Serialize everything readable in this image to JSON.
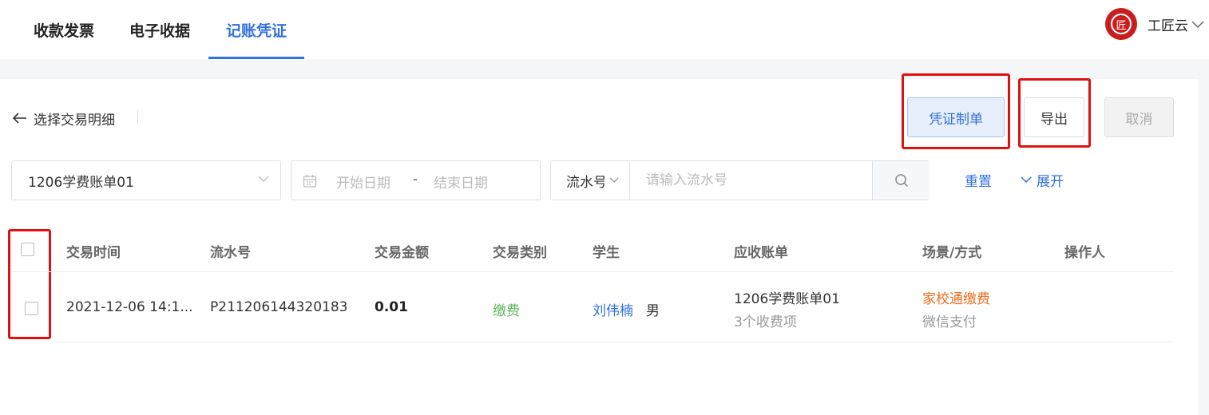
{
  "tabs": [
    {
      "label": "收款发票"
    },
    {
      "label": "电子收据"
    },
    {
      "label": "记账凭证",
      "active": true
    }
  ],
  "brand": {
    "name": "工匠云",
    "logo_char": "匠",
    "logo_color": "#c81e1e"
  },
  "toolbar": {
    "back_label": "选择交易明细",
    "voucher_button": "凭证制单",
    "export_button": "导出",
    "cancel_button": "取消"
  },
  "filters": {
    "bill_select": "1206学费账单01",
    "date_start_placeholder": "开始日期",
    "date_separator": "-",
    "date_end_placeholder": "结束日期",
    "search_type": "流水号",
    "search_placeholder": "请输入流水号",
    "reset_label": "重置",
    "expand_label": "展开"
  },
  "table": {
    "columns": [
      "交易时间",
      "流水号",
      "交易金额",
      "交易类别",
      "学生",
      "应收账单",
      "场景/方式",
      "操作人"
    ],
    "rows": [
      {
        "time": "2021-12-06 14:1...",
        "serial": "P211206144320183",
        "amount": "0.01",
        "category": "缴费",
        "student_name": "刘伟楠",
        "student_gender": "男",
        "bill_name": "1206学费账单01",
        "bill_items": "3个收费项",
        "scene": "家校通缴费",
        "method": "微信支付",
        "operator": ""
      }
    ]
  },
  "colors": {
    "accent": "#3170e0",
    "highlight": "#e01010",
    "category": "#5cb85c",
    "scene": "#f26b1d"
  }
}
